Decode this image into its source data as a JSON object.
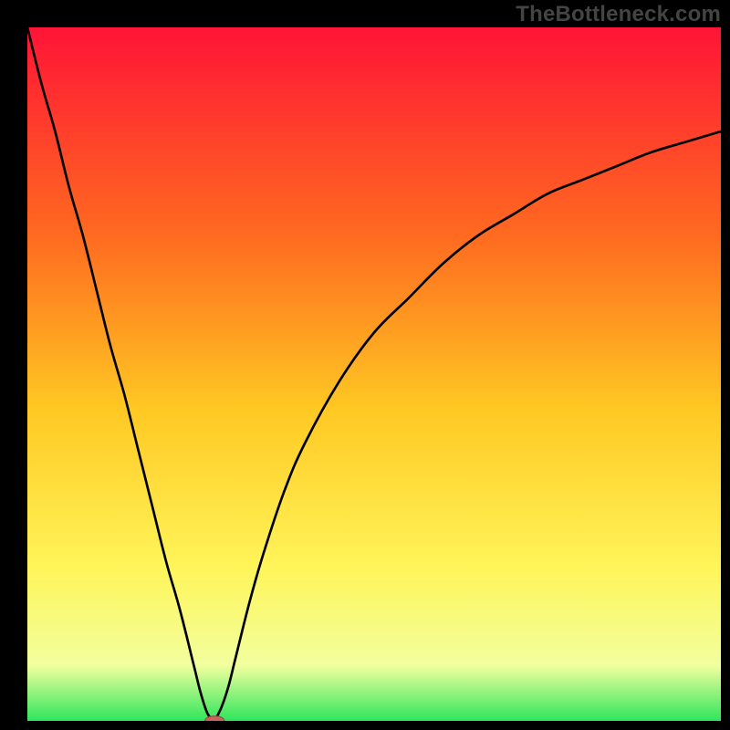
{
  "watermark": "TheBottleneck.com",
  "colors": {
    "bg": "#000000",
    "gradient_top": "#ff1436",
    "gradient_mid_upper": "#ff6a20",
    "gradient_mid": "#ffc822",
    "gradient_mid_lower": "#fff55a",
    "gradient_lower": "#f2ff9e",
    "gradient_bottom": "#2fe65c",
    "curve": "#000000",
    "marker_fill": "#c9645f",
    "marker_stroke": "#9c4a45"
  },
  "chart_data": {
    "type": "line",
    "title": "",
    "xlabel": "",
    "ylabel": "",
    "xlim": [
      0,
      100
    ],
    "ylim": [
      0,
      100
    ],
    "x_optimal": 27,
    "left_curve": {
      "x": [
        0,
        2,
        4,
        6,
        8,
        10,
        12,
        14,
        16,
        18,
        20,
        22,
        24,
        25,
        26,
        27
      ],
      "y": [
        100,
        92,
        85,
        77,
        70,
        62,
        54,
        47,
        39,
        31,
        23,
        16,
        8,
        4,
        1,
        0
      ]
    },
    "right_curve": {
      "x": [
        27,
        28,
        29,
        30,
        32,
        34,
        37,
        40,
        45,
        50,
        55,
        60,
        65,
        70,
        75,
        80,
        85,
        90,
        95,
        100
      ],
      "y": [
        0,
        2,
        5,
        9,
        17,
        24,
        33,
        40,
        49,
        56,
        61,
        66,
        70,
        73,
        76,
        78,
        80,
        82,
        83.5,
        85
      ]
    },
    "marker": {
      "x": 27,
      "y": 0,
      "rx": 1.4,
      "ry": 0.7
    }
  }
}
